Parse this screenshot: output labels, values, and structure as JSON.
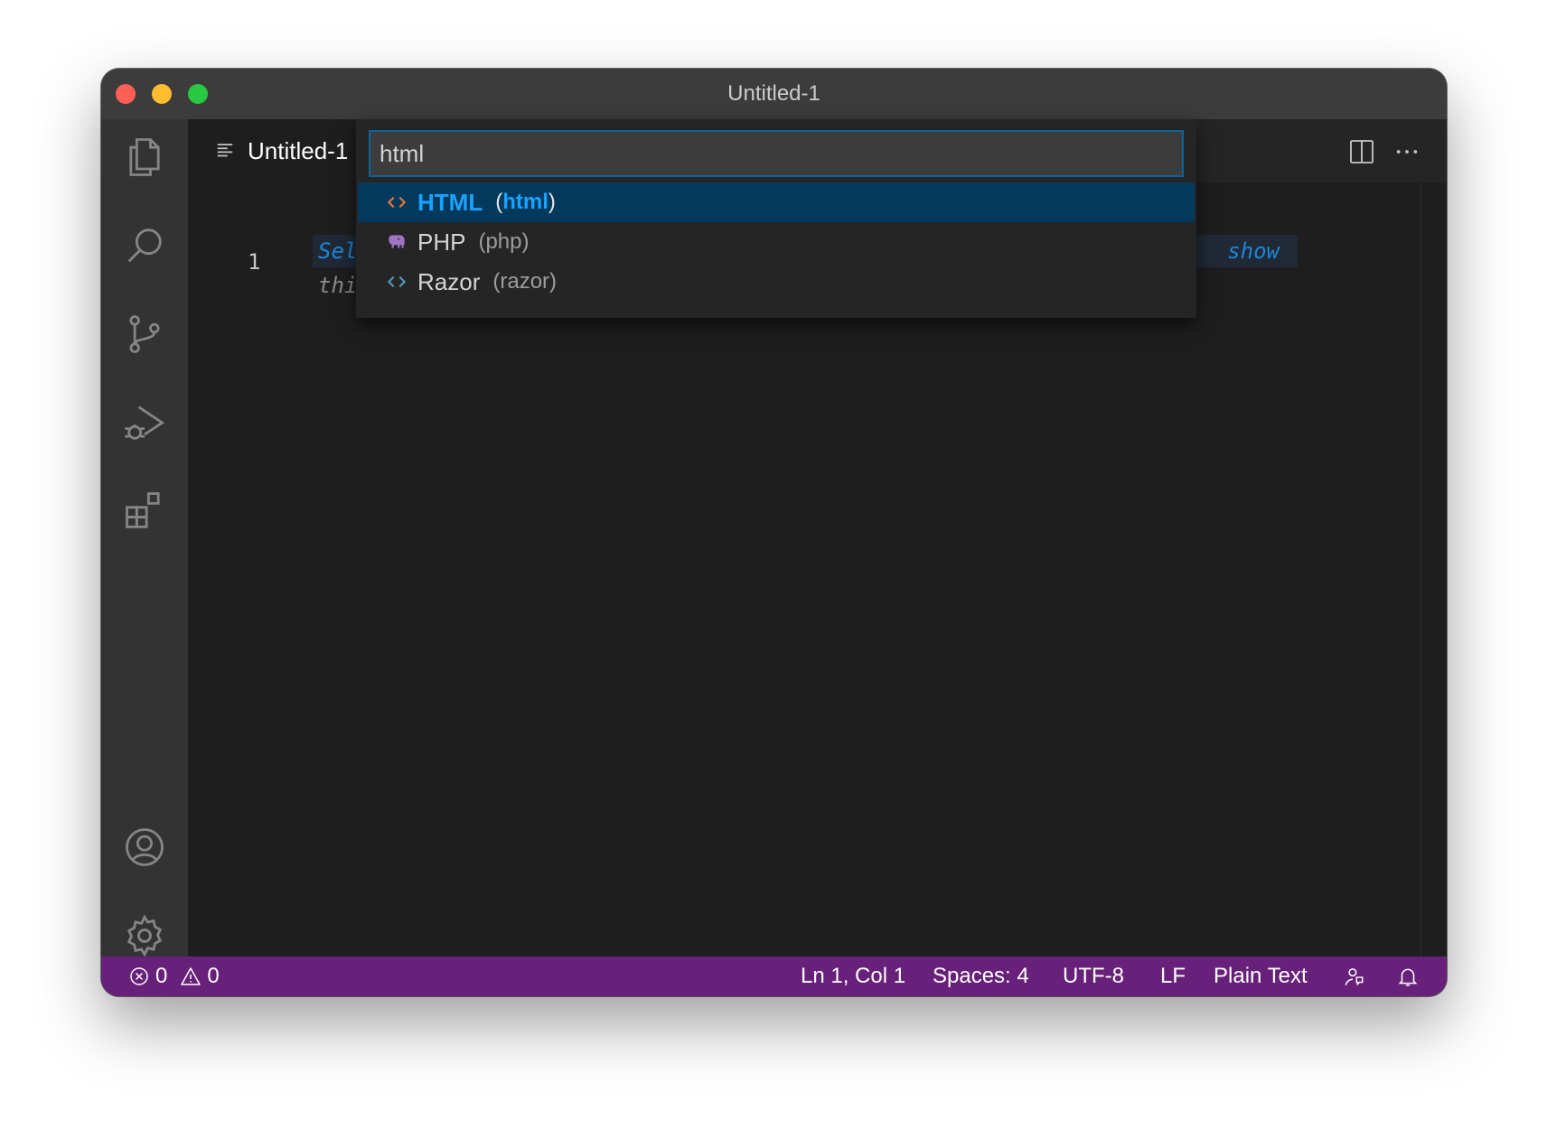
{
  "window": {
    "title": "Untitled-1"
  },
  "tab": {
    "label": "Untitled-1"
  },
  "editor": {
    "line_number": "1",
    "hint_line1_start": "Sel",
    "hint_line1_end": "show",
    "hint_line2_start": "thi"
  },
  "quick_pick": {
    "input_value": "html",
    "items": [
      {
        "label": "HTML",
        "desc_open": "(",
        "desc_match": "html",
        "desc_close": ")",
        "icon": "code-brackets-icon",
        "icon_color": "#e37933"
      },
      {
        "label": "PHP",
        "desc": "(php)",
        "icon": "php-elephant-icon",
        "icon_color": "#a074c4"
      },
      {
        "label": "Razor",
        "desc": "(razor)",
        "icon": "code-brackets-icon",
        "icon_color": "#519aba"
      }
    ]
  },
  "statusbar": {
    "errors": "0",
    "warnings": "0",
    "position": "Ln 1, Col 1",
    "spaces": "Spaces: 4",
    "encoding": "UTF-8",
    "eol": "LF",
    "language": "Plain Text"
  },
  "colors": {
    "statusbar_bg": "#68217a",
    "selection_bg": "#04395e",
    "accent": "#18a3ff",
    "input_border": "#0e639c"
  }
}
